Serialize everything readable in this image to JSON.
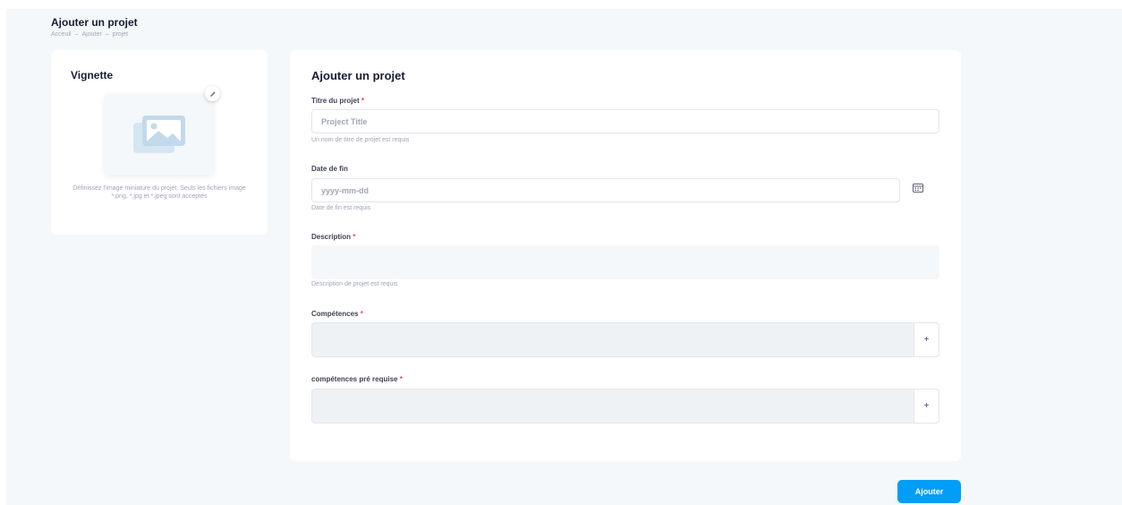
{
  "header": {
    "title": "Ajouter un projet",
    "breadcrumb": [
      "Acceuil",
      "Ajouter",
      "projet"
    ],
    "breadcrumb_sep": "–"
  },
  "thumbnail": {
    "title": "Vignette",
    "hint": "Définissez l'image miniature du projet. Seuls les fichiers image *.png, *.jpg et *.jpeg sont acceptés",
    "edit_icon": "pencil-icon",
    "placeholder_icon": "image-icon"
  },
  "form": {
    "title": "Ajouter un projet",
    "required_mark": "*",
    "project_title": {
      "label": "Titre du projet",
      "placeholder": "Project Title",
      "value": "",
      "hint": "Un nom de titre de projet est requis"
    },
    "end_date": {
      "label": "Date de fin",
      "placeholder": "yyyy-mm-dd",
      "value": "",
      "hint": "Date de fin est requis",
      "icon": "calendar-icon"
    },
    "description": {
      "label": "Description",
      "value": "",
      "hint": "Description de projet est requis"
    },
    "skills": {
      "label": "Compétences",
      "add_label": "+"
    },
    "prerequisite_skills": {
      "label": "compétences pré requise",
      "add_label": "+"
    },
    "submit_label": "Ajouter"
  },
  "colors": {
    "accent": "#009ef7",
    "required": "#f1416c",
    "background": "#f5f8fa"
  }
}
